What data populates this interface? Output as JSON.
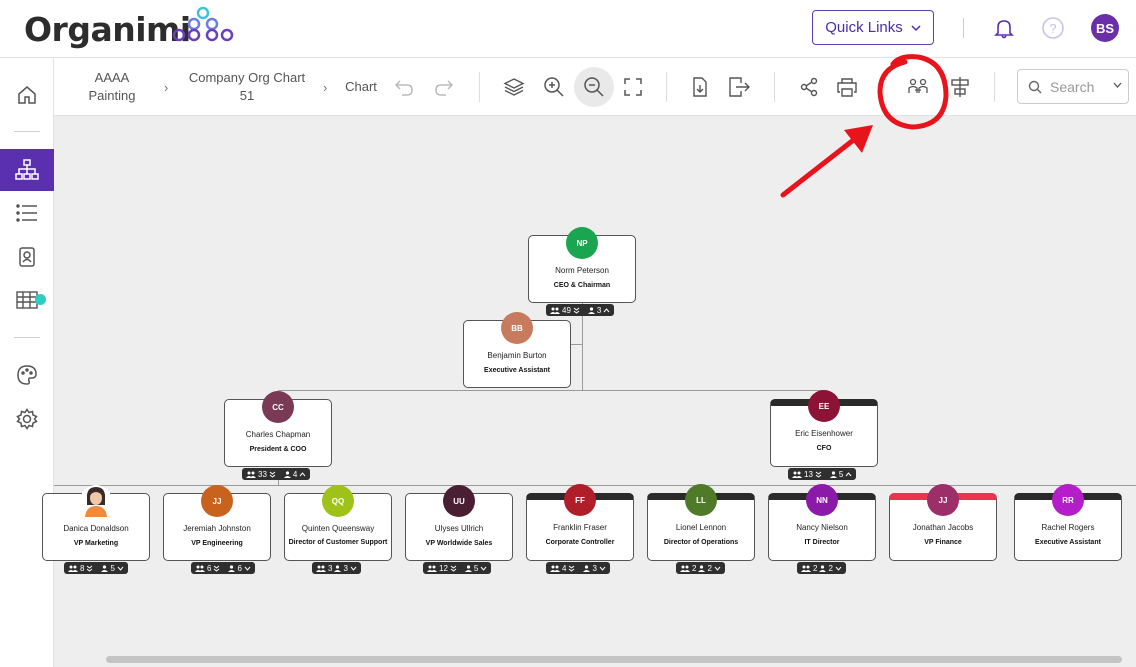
{
  "header": {
    "logo_text": "Organimi",
    "quick_links_label": "Quick Links",
    "user_initials": "BS",
    "help_glyph": "?"
  },
  "toolbar": {
    "breadcrumb": [
      {
        "line1": "AAAA",
        "line2": "Painting"
      },
      {
        "line1": "Company Org Chart",
        "line2": "51"
      },
      {
        "line1": "Chart",
        "line2": ""
      }
    ],
    "breadcrumb_sep": "›",
    "search_placeholder": "Search",
    "icons": [
      "undo-icon",
      "redo-icon",
      "layers-icon",
      "zoom-in-icon",
      "zoom-out-icon",
      "fit-screen-icon",
      "import-icon",
      "export-icon",
      "share-icon",
      "print-icon",
      "compare-people-icon",
      "align-icon",
      "search-icon"
    ]
  },
  "sidebar": {
    "items": [
      "home-icon",
      "org-chart-icon",
      "list-icon",
      "directory-icon",
      "table-icon",
      "palette-icon",
      "settings-icon"
    ]
  },
  "colors": {
    "brand": "#5a2fb0",
    "annotation": "#e8141c",
    "teal_dot": "#2ecfc0"
  },
  "chart": {
    "ceo": {
      "initials": "NP",
      "name": "Norm Peterson",
      "title": "CEO & Chairman",
      "color": "#1aa550",
      "counter": {
        "total": "49",
        "direct": "3"
      }
    },
    "assistant": {
      "initials": "BB",
      "name": "Benjamin Burton",
      "title": "Executive Assistant",
      "color": "#c87a5e"
    },
    "level2": [
      {
        "initials": "CC",
        "name": "Charles Chapman",
        "title": "President & COO",
        "color": "#7a3a55",
        "counter": {
          "total": "33",
          "direct": "4"
        }
      },
      {
        "initials": "EE",
        "name": "Eric Eisenhower",
        "title": "CFO",
        "color": "#8c1236",
        "counter": {
          "total": "13",
          "direct": "5"
        }
      }
    ],
    "level3": [
      {
        "initials": "",
        "name": "Danica Donaldson",
        "title": "VP Marketing",
        "color": "#ffffff",
        "photo": true,
        "counter": {
          "total": "8",
          "direct": "5"
        }
      },
      {
        "initials": "JJ",
        "name": "Jeremiah Johnston",
        "title": "VP Engineering",
        "color": "#c9621c",
        "counter": {
          "total": "6",
          "direct": "6"
        }
      },
      {
        "initials": "QQ",
        "name": "Quinten Queensway",
        "title": "Director of Customer Support",
        "color": "#9ec21a",
        "counter": {
          "total": "3",
          "direct": "3"
        }
      },
      {
        "initials": "UU",
        "name": "Ulyses Ullrich",
        "title": "VP Worldwide Sales",
        "color": "#4a1f33",
        "counter": {
          "total": "12",
          "direct": "5"
        }
      },
      {
        "initials": "FF",
        "name": "Franklin Fraser",
        "title": "Corporate Controller",
        "color": "#b01e2a",
        "counter": {
          "total": "4",
          "direct": "3"
        }
      },
      {
        "initials": "LL",
        "name": "Lionel Lennon",
        "title": "Director of Operations",
        "color": "#4f7a2a",
        "counter": {
          "total": "2",
          "direct": "2"
        }
      },
      {
        "initials": "NN",
        "name": "Nancy Nielson",
        "title": "IT Director",
        "color": "#8c1aa8",
        "counter": {
          "total": "2",
          "direct": "2"
        }
      },
      {
        "initials": "JJ",
        "name": "Jonathan Jacobs",
        "title": "VP Finance",
        "color": "#9c2f6a"
      },
      {
        "initials": "RR",
        "name": "Rachel Rogers",
        "title": "Executive Assistant",
        "color": "#b41ec8"
      }
    ]
  }
}
